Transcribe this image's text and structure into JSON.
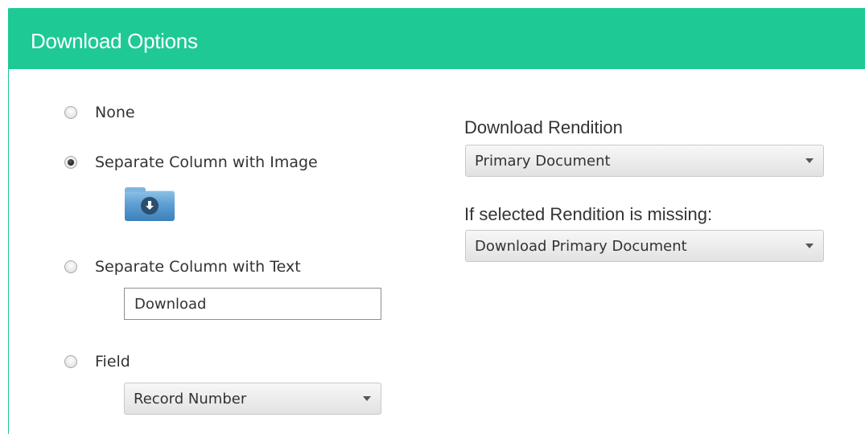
{
  "header": {
    "title": "Download Options"
  },
  "options": [
    {
      "label": "None",
      "checked": false
    },
    {
      "label": "Separate Column with Image",
      "checked": true
    },
    {
      "label": "Separate Column with Text",
      "checked": false
    },
    {
      "label": "Field",
      "checked": false
    }
  ],
  "image_option": {
    "icon": "download-folder-icon"
  },
  "text_option": {
    "value": "Download"
  },
  "field_option": {
    "selected": "Record Number"
  },
  "rendition": {
    "label": "Download Rendition",
    "selected": "Primary Document"
  },
  "missing_rendition": {
    "label": "If selected Rendition is missing:",
    "selected": "Download Primary Document"
  },
  "colors": {
    "header_bg": "#1ec995",
    "header_text": "#ffffff"
  }
}
